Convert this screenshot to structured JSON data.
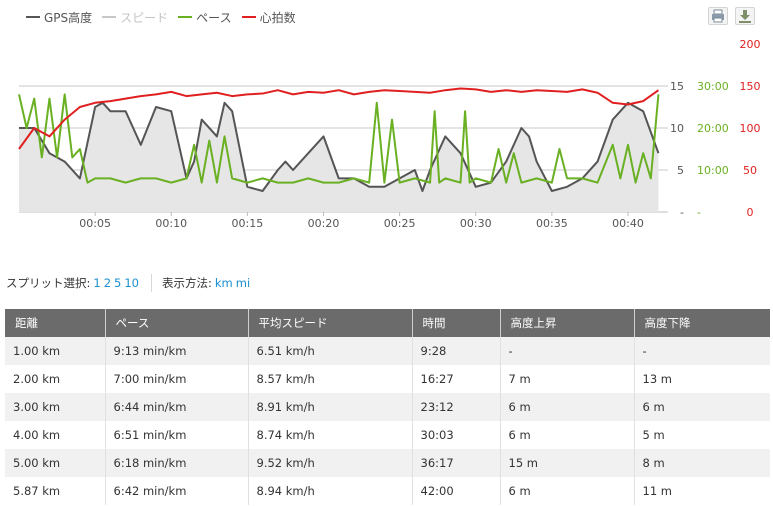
{
  "legend": [
    {
      "label": "GPS高度",
      "color": "#555555"
    },
    {
      "label": "スピード",
      "color": "#c8c8c8"
    },
    {
      "label": "ペース",
      "color": "#6ab023"
    },
    {
      "label": "心拍数",
      "color": "#e02020"
    }
  ],
  "toolbar": {
    "print_icon": "print-icon",
    "download_icon": "download-icon"
  },
  "chart_data": {
    "type": "line",
    "x_ticks": [
      "00:05",
      "00:10",
      "00:15",
      "00:20",
      "00:25",
      "00:30",
      "00:35",
      "00:40"
    ],
    "x_range_minutes": [
      0,
      42.3
    ],
    "axes": {
      "altitude": {
        "ticks": [
          "15",
          "10",
          "5",
          "-"
        ],
        "range": [
          0,
          20
        ],
        "color": "#555555"
      },
      "pace": {
        "ticks": [
          "30:00",
          "20:00",
          "10:00",
          "-"
        ],
        "range_minutes": [
          0,
          40
        ],
        "color": "#6ab023"
      },
      "heart_rate": {
        "ticks": [
          "200",
          "150",
          "100",
          "50",
          "0"
        ],
        "range": [
          0,
          200
        ],
        "color": "#e02020"
      }
    },
    "grid": "horizontal",
    "series": [
      {
        "name": "GPS高度",
        "type": "area",
        "color": "#555555",
        "fill": "#e6e6e6",
        "x": [
          0,
          1,
          2,
          3,
          4,
          5,
          5.5,
          6,
          7,
          7.5,
          8,
          9,
          10,
          11,
          11.5,
          12,
          13,
          13.5,
          14,
          15,
          16,
          17,
          17.5,
          18,
          19,
          20,
          21,
          22,
          23,
          24,
          25,
          26,
          26.5,
          27,
          28,
          29,
          30,
          31,
          32,
          33,
          33.5,
          34,
          35,
          36,
          37,
          38,
          39,
          40,
          41,
          42
        ],
        "values": [
          10,
          10,
          7,
          6,
          4,
          12.5,
          13,
          12,
          12,
          10,
          8,
          12.5,
          12,
          4,
          6,
          11,
          9,
          13,
          12,
          3,
          2.5,
          5,
          6,
          5,
          7,
          9,
          4,
          4,
          3,
          3,
          4,
          5,
          2.5,
          5,
          9,
          7,
          3,
          3.5,
          6,
          10,
          9,
          6,
          2.5,
          3,
          4,
          6,
          11,
          13,
          12,
          7
        ]
      },
      {
        "name": "ペース",
        "type": "line",
        "color": "#6ab023",
        "x": [
          0,
          0.5,
          1,
          1.5,
          2,
          2.5,
          3,
          3.5,
          4,
          4.5,
          5,
          6,
          7,
          8,
          9,
          10,
          11,
          11.5,
          12,
          12.5,
          13,
          13.5,
          14,
          15,
          16,
          17,
          18,
          19,
          20,
          21,
          22,
          23,
          23.5,
          24,
          24.5,
          25,
          26,
          27,
          27.3,
          27.6,
          28,
          29,
          29.3,
          29.6,
          30,
          31,
          31.5,
          32,
          32.5,
          33,
          34,
          35,
          35.5,
          36,
          37,
          38,
          39,
          39.5,
          40,
          40.5,
          41,
          41.5,
          42
        ],
        "values": [
          28,
          20,
          27,
          13,
          27,
          13,
          28,
          13,
          15,
          7,
          8,
          8,
          7,
          8,
          8,
          7,
          8,
          16,
          7,
          17,
          7,
          18,
          8,
          7,
          8,
          7,
          7,
          8,
          7,
          7,
          8,
          7,
          26,
          7,
          22,
          7,
          8,
          7,
          24,
          7,
          8,
          7,
          24,
          7,
          8,
          7,
          15,
          7,
          14,
          7,
          8,
          7,
          15,
          8,
          8,
          7,
          16,
          8,
          16,
          7,
          14,
          8,
          28
        ]
      },
      {
        "name": "心拍数",
        "type": "line",
        "color": "#e02020",
        "x": [
          0,
          1,
          2,
          3,
          4,
          5,
          6,
          7,
          8,
          9,
          10,
          11,
          12,
          13,
          14,
          15,
          16,
          17,
          18,
          19,
          20,
          21,
          22,
          23,
          24,
          25,
          26,
          27,
          28,
          29,
          30,
          31,
          32,
          33,
          34,
          35,
          36,
          37,
          38,
          39,
          40,
          41,
          42
        ],
        "values": [
          75,
          100,
          90,
          110,
          125,
          130,
          132,
          135,
          138,
          140,
          143,
          138,
          140,
          142,
          138,
          140,
          141,
          145,
          140,
          143,
          142,
          145,
          140,
          143,
          145,
          144,
          143,
          142,
          145,
          147,
          146,
          143,
          145,
          143,
          145,
          144,
          143,
          146,
          142,
          130,
          128,
          132,
          145
        ]
      }
    ]
  },
  "split_select": {
    "label": "スプリット選択:",
    "options": [
      "1",
      "2",
      "5",
      "10"
    ],
    "view_label": "表示方法:",
    "units": [
      "km",
      "mi"
    ]
  },
  "table": {
    "headers": [
      "距離",
      "ペース",
      "平均スピード",
      "時間",
      "高度上昇",
      "高度下降"
    ],
    "rows": [
      [
        "1.00 km",
        "9:13 min/km",
        "6.51 km/h",
        "9:28",
        "-",
        "-"
      ],
      [
        "2.00 km",
        "7:00 min/km",
        "8.57 km/h",
        "16:27",
        "7 m",
        "13 m"
      ],
      [
        "3.00 km",
        "6:44 min/km",
        "8.91 km/h",
        "23:12",
        "6 m",
        "6 m"
      ],
      [
        "4.00 km",
        "6:51 min/km",
        "8.74 km/h",
        "30:03",
        "6 m",
        "5 m"
      ],
      [
        "5.00 km",
        "6:18 min/km",
        "9.52 km/h",
        "36:17",
        "15 m",
        "8 m"
      ],
      [
        "5.87 km",
        "6:42 min/km",
        "8.94 km/h",
        "42:00",
        "6 m",
        "11 m"
      ]
    ]
  }
}
